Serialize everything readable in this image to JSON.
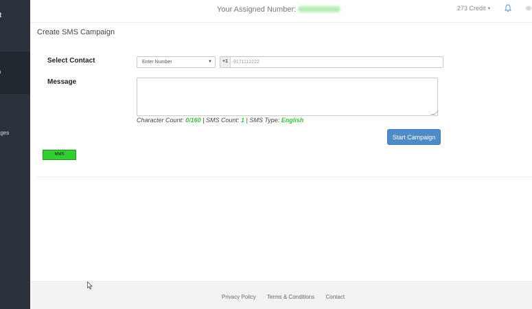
{
  "sidebar": {
    "fragments": [
      "t",
      "n",
      "ages"
    ]
  },
  "header": {
    "assigned_label": "Your Assigned Number:",
    "credit": "273 Credit"
  },
  "page": {
    "title": "Create SMS Campaign"
  },
  "form": {
    "contact_label": "Select Contact",
    "select_value": "Enter Number",
    "country_code": "+1",
    "phone_placeholder": "9171112222",
    "message_label": "Message",
    "char_count_label": "Character Count:",
    "char_count_value": "0/160",
    "sep1": "|",
    "sms_count_label": "SMS Count:",
    "sms_count_value": "1",
    "sep2": "|",
    "sms_type_label": "SMS Type:",
    "sms_type_value": "English",
    "start_button": "Start Campaign",
    "mms_button": "MMS"
  },
  "footer": {
    "links": [
      "Privacy Policy",
      "Terms & Conditions",
      "Contact"
    ]
  },
  "colors": {
    "sidebar_bg": "#2b323c",
    "primary_button": "#4f8bc6",
    "mms_green": "#33cc33",
    "count_green": "#3dbf3d"
  }
}
